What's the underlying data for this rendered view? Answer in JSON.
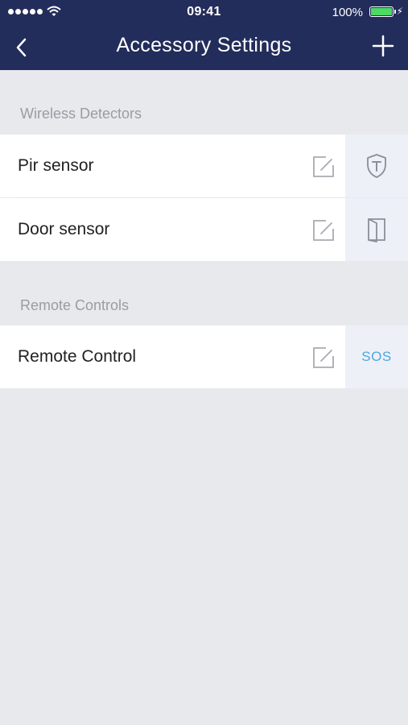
{
  "status_bar": {
    "time": "09:41",
    "battery_percent": "100%",
    "battery_level": 1.0,
    "battery_color": "#4cd964",
    "signal_icon": "signal-dots-icon",
    "wifi_icon": "wifi-icon",
    "charging_icon": "bolt-icon"
  },
  "nav": {
    "title": "Accessory Settings",
    "back_icon": "chevron-left-icon",
    "add_icon": "plus-icon",
    "background_color": "#232d5b"
  },
  "sections": [
    {
      "header": "Wireless Detectors",
      "items": [
        {
          "label": "Pir sensor",
          "edit_icon": "edit-icon",
          "action_icon": "shield-icon"
        },
        {
          "label": "Door sensor",
          "edit_icon": "edit-icon",
          "action_icon": "door-icon"
        }
      ]
    },
    {
      "header": "Remote Controls",
      "items": [
        {
          "label": "Remote Control",
          "edit_icon": "edit-icon",
          "action_text": "SOS",
          "action_color": "#4aa8e0"
        }
      ]
    }
  ]
}
